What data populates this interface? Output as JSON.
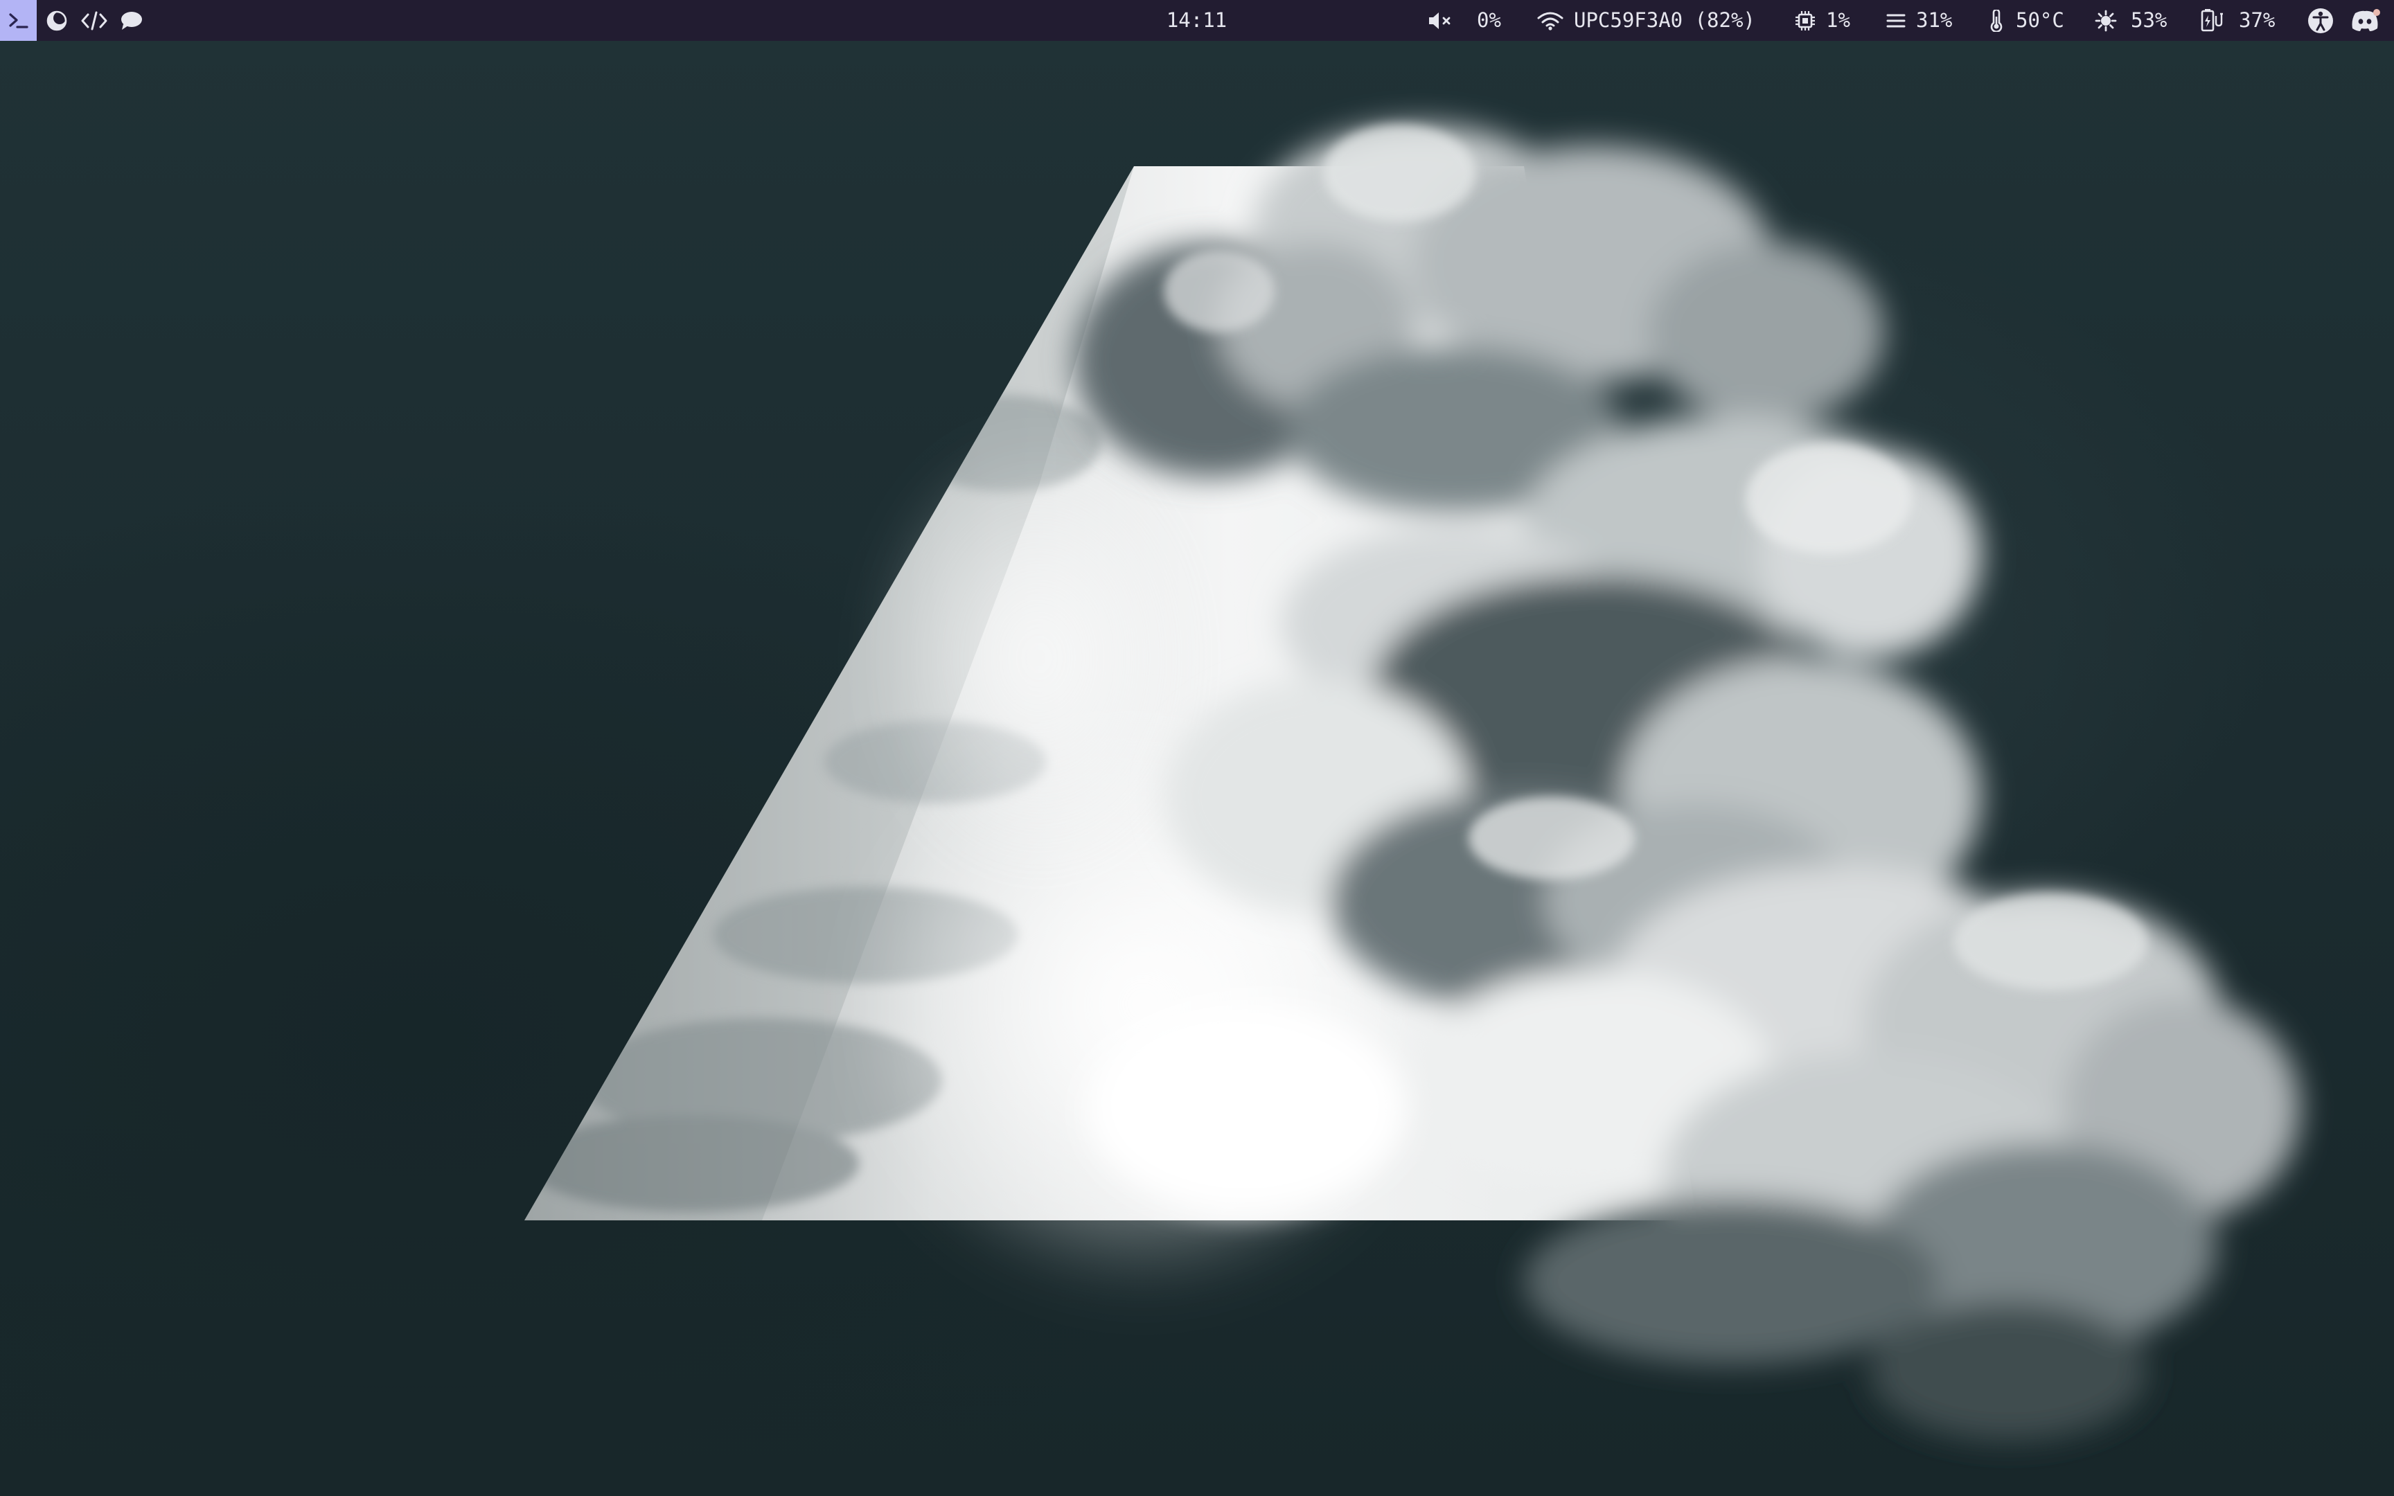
{
  "topbar": {
    "clock": "14:11",
    "volume": "0%",
    "wifi": "UPC59F3A0 (82%)",
    "cpu": "1%",
    "memory": "31%",
    "temperature": "50°C",
    "brightness": "53%",
    "battery": "37%"
  },
  "icons": {
    "launcher": "terminal-icon",
    "left": [
      "moon-icon",
      "code-icon",
      "chat-bubble-icon"
    ],
    "right": [
      "speaker-muted-icon",
      "wifi-icon",
      "cpu-chip-icon",
      "memory-bars-icon",
      "thermometer-icon",
      "sun-icon",
      "battery-charging-icon",
      "accessibility-icon",
      "discord-icon"
    ]
  },
  "colors": {
    "bar_background": "#221c31",
    "launcher_accent": "#b3b4f5",
    "bar_text": "#e6e6ee",
    "desktop_background": "#1c2d31",
    "notification_dot": "#e8b9b0"
  }
}
